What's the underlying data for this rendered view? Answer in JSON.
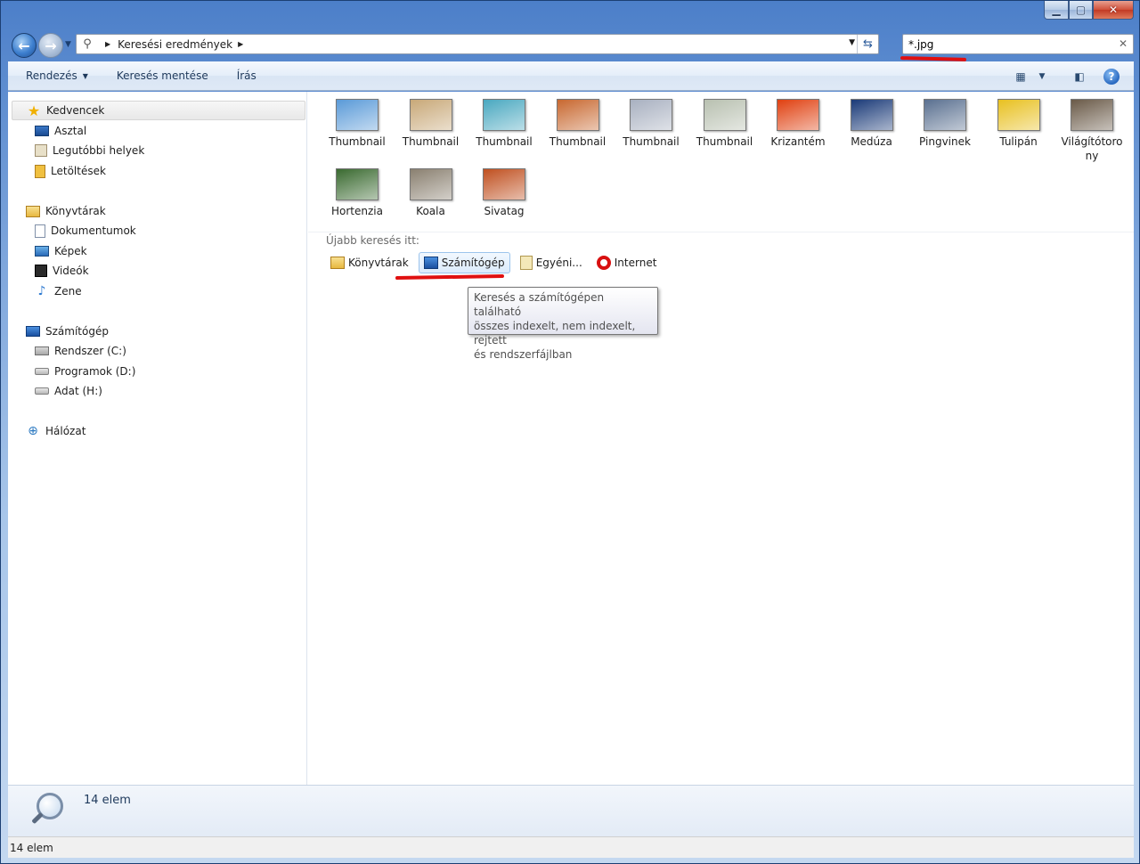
{
  "window": {
    "controls": {
      "minimize": "▁",
      "maximize": "▢",
      "close": "✕"
    }
  },
  "address": {
    "crumb": "Keresési eredmények"
  },
  "search": {
    "value": "*.jpg"
  },
  "toolbar": {
    "organize_label": "Rendezés",
    "save_search_label": "Keresés mentése",
    "burn_label": "Írás"
  },
  "nav": {
    "favorites": {
      "label": "Kedvencek",
      "items": [
        {
          "label": "Asztal"
        },
        {
          "label": "Legutóbbi helyek"
        },
        {
          "label": "Letöltések"
        }
      ]
    },
    "libraries": {
      "label": "Könyvtárak",
      "items": [
        {
          "label": "Dokumentumok"
        },
        {
          "label": "Képek"
        },
        {
          "label": "Videók"
        },
        {
          "label": "Zene"
        }
      ]
    },
    "computer": {
      "label": "Számítógép",
      "items": [
        {
          "label": "Rendszer (C:)"
        },
        {
          "label": "Programok (D:)"
        },
        {
          "label": "Adat (H:)"
        }
      ]
    },
    "network": {
      "label": "Hálózat"
    }
  },
  "results": [
    {
      "label": "Thumbnail",
      "color": "#5a9ad8"
    },
    {
      "label": "Thumbnail",
      "color": "#c8a878"
    },
    {
      "label": "Thumbnail",
      "color": "#4aa8c0"
    },
    {
      "label": "Thumbnail",
      "color": "#c86830"
    },
    {
      "label": "Thumbnail",
      "color": "#a8b0c0"
    },
    {
      "label": "Thumbnail",
      "color": "#b8c0b0"
    },
    {
      "label": "Krizantém",
      "color": "#e04010"
    },
    {
      "label": "Medúza",
      "color": "#1a3a78"
    },
    {
      "label": "Pingvinek",
      "color": "#5a7090"
    },
    {
      "label": "Tulipán",
      "color": "#e8c020"
    },
    {
      "label": "Világítótorony",
      "label_line1": "Világítótoro",
      "label_line2": "ny",
      "color": "#6a5a48"
    },
    {
      "label": "Hortenzia",
      "color": "#3a6a30"
    },
    {
      "label": "Koala",
      "color": "#8a8070"
    },
    {
      "label": "Sivatag",
      "color": "#c05020"
    }
  ],
  "search_again": {
    "label": "Újabb keresés itt:",
    "options": [
      {
        "label": "Könyvtárak"
      },
      {
        "label": "Számítógép"
      },
      {
        "label": "Egyéni..."
      },
      {
        "label": "Internet"
      }
    ]
  },
  "tooltip": {
    "line1": "Keresés a számítógépen található",
    "line2": "összes indexelt, nem indexelt, rejtett",
    "line3": "és rendszerfájlban"
  },
  "details": {
    "count": "14 elem"
  },
  "status": {
    "count": "14 elem"
  }
}
